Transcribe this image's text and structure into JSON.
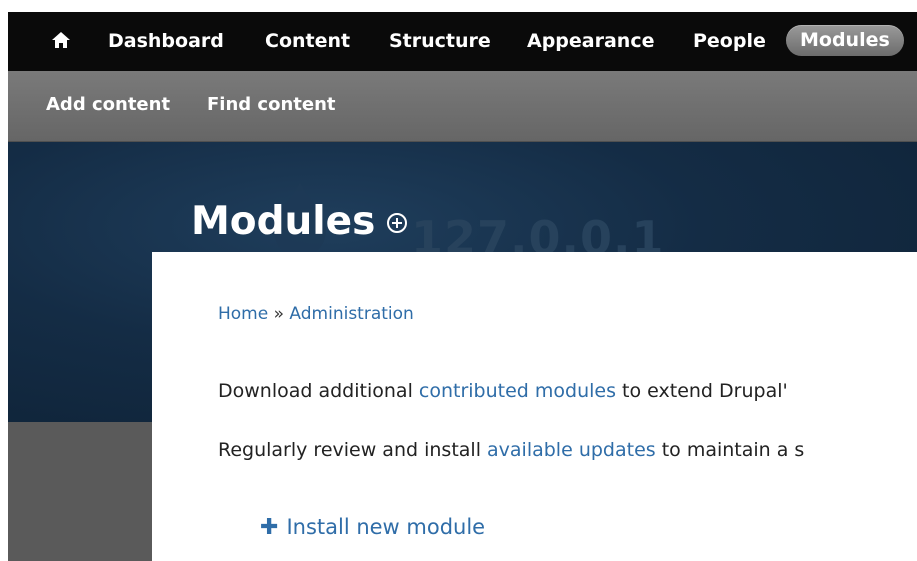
{
  "toolbar": {
    "items": [
      {
        "label": "Dashboard"
      },
      {
        "label": "Content"
      },
      {
        "label": "Structure"
      },
      {
        "label": "Appearance"
      },
      {
        "label": "People"
      },
      {
        "label": "Modules",
        "active": true
      }
    ]
  },
  "shortcuts": {
    "items": [
      {
        "label": "Add content"
      },
      {
        "label": "Find content"
      }
    ]
  },
  "header": {
    "site_name": "127.0.0.1",
    "page_title": "Modules"
  },
  "breadcrumb": {
    "home": "Home",
    "separator": " » ",
    "administration": "Administration"
  },
  "help": {
    "line1_prefix": "Download additional ",
    "line1_link": "contributed modules",
    "line1_suffix": " to extend Drupal'",
    "line2_prefix": "Regularly review and install ",
    "line2_link": "available updates",
    "line2_suffix": " to maintain a s"
  },
  "actions": {
    "install_new_module": "Install new module",
    "plus_glyph": "✚"
  },
  "colors": {
    "toolbar_bg": "#0a0a0a",
    "shortcut_bg": "#6f6f6f",
    "header_bg": "#142c45",
    "link": "#2f6da8",
    "active_tab": "#7b7b7b"
  }
}
